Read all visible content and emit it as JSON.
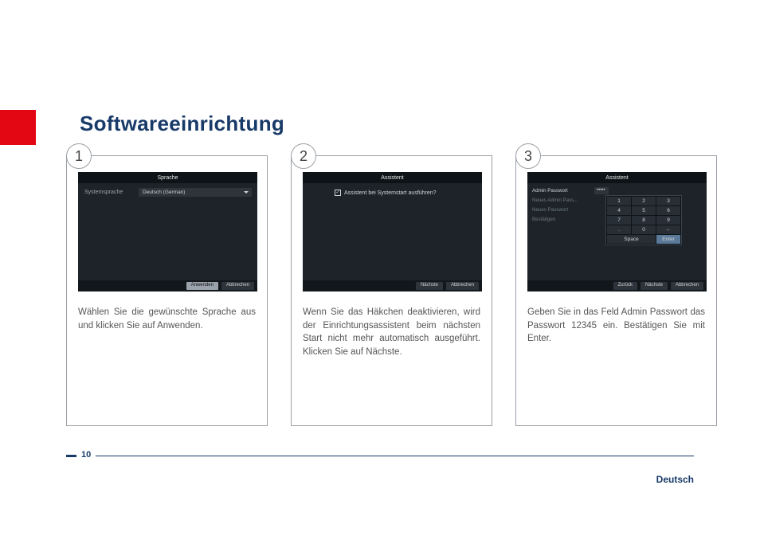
{
  "page": {
    "title": "Softwareeinrichtung",
    "number": "10",
    "language": "Deutsch"
  },
  "steps": [
    {
      "num": "1",
      "caption": "Wählen Sie die gewünschte Sprache aus und klicken Sie auf Anwenden.",
      "dialog_title": "Sprache",
      "field_label": "Systemsprache",
      "field_value": "Deutsch (German)",
      "buttons": {
        "apply": "Anwenden",
        "cancel": "Abbrechen"
      }
    },
    {
      "num": "2",
      "caption": "Wenn Sie das Häkchen deaktivieren, wird der Einrichtungsassistent beim nächsten Start nicht mehr automatisch ausgeführt. Klicken Sie auf Nächste.",
      "dialog_title": "Assistent",
      "checkbox_label": "Assistent bei Systemstart ausführen?",
      "buttons": {
        "next": "Nächste",
        "cancel": "Abbrechen"
      }
    },
    {
      "num": "3",
      "caption": "Geben Sie in das Feld Admin Passwort das Passwort 12345 ein. Bestätigen Sie mit Enter.",
      "dialog_title": "Assistent",
      "fields": {
        "admin_pw": "Admin Passwort",
        "admin_pw_value": "•••••",
        "new_admin_pw": "Neues Admin Pass...",
        "new_pw": "Neues Passwort",
        "confirm": "Bestätigen"
      },
      "keypad": {
        "keys": [
          "1",
          "2",
          "3",
          "4",
          "5",
          "6",
          "7",
          "8",
          "9",
          ".",
          "0",
          "←",
          "Space",
          "Enter"
        ]
      },
      "buttons": {
        "back": "Zurück",
        "next": "Nächste",
        "cancel": "Abbrechen"
      }
    }
  ]
}
